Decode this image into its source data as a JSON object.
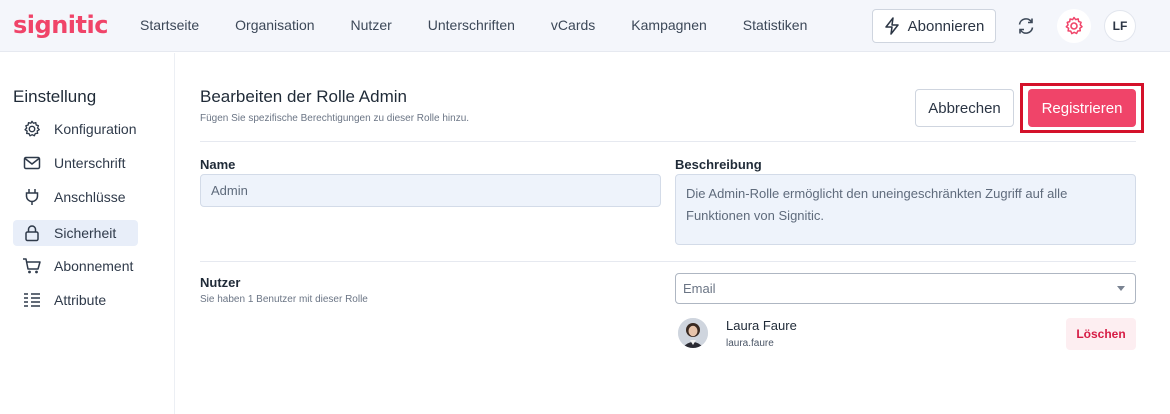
{
  "brand": {
    "logo_text": "signitic",
    "accent": "#f04469"
  },
  "nav": {
    "items": [
      {
        "label": "Startseite"
      },
      {
        "label": "Organisation"
      },
      {
        "label": "Nutzer"
      },
      {
        "label": "Unterschriften"
      },
      {
        "label": "vCards"
      },
      {
        "label": "Kampagnen"
      },
      {
        "label": "Statistiken"
      }
    ],
    "subscribe_label": "Abonnieren",
    "user_initials": "LF"
  },
  "sidebar": {
    "title": "Einstellung",
    "items": [
      {
        "label": "Konfiguration",
        "icon": "gear-icon"
      },
      {
        "label": "Unterschrift",
        "icon": "mail-icon"
      },
      {
        "label": "Anschlüsse",
        "icon": "plug-icon"
      },
      {
        "label": "Sicherheit",
        "icon": "lock-icon",
        "active": true
      },
      {
        "label": "Abonnement",
        "icon": "cart-icon"
      },
      {
        "label": "Attribute",
        "icon": "list-icon"
      }
    ]
  },
  "header": {
    "title": "Bearbeiten der Rolle Admin",
    "subtitle": "Fügen Sie spezifische Berechtigungen zu dieser Rolle hinzu.",
    "cancel_label": "Abbrechen",
    "register_label": "Registrieren"
  },
  "form": {
    "name_label": "Name",
    "name_value": "Admin",
    "description_label": "Beschreibung",
    "description_value": "Die Admin-Rolle ermöglicht den uneingeschränkten Zugriff auf alle Funktionen von Signitic."
  },
  "users": {
    "label": "Nutzer",
    "subtitle": "Sie haben 1 Benutzer mit dieser Rolle",
    "email_placeholder": "Email",
    "list": [
      {
        "name": "Laura Faure",
        "email": "laura.faure",
        "delete_label": "Löschen"
      }
    ]
  }
}
